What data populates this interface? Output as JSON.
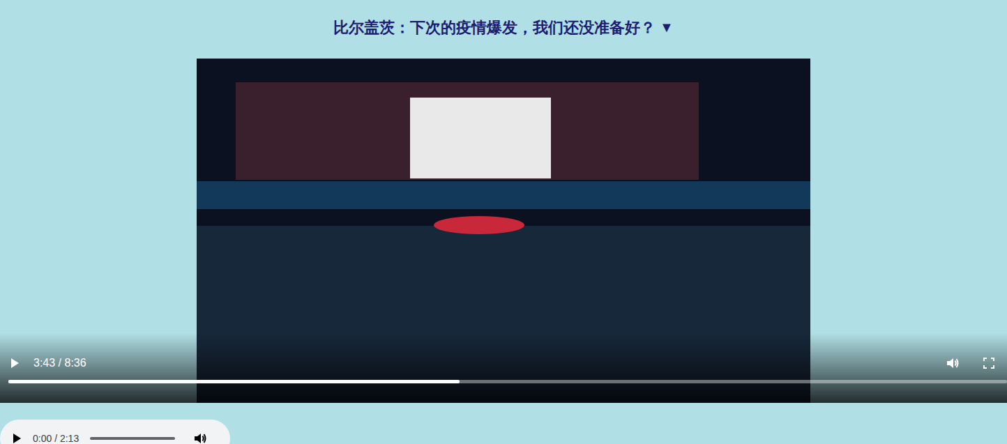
{
  "header": {
    "title": "比尔盖茨：下次的疫情爆发，我们还没准备好？",
    "toggle": "▼"
  },
  "video": {
    "paused": true,
    "time": "3:43 / 8:36",
    "level": 0.452
  },
  "audio": {
    "paused": true,
    "time": "0:00 / 2:13",
    "level": 0
  }
}
